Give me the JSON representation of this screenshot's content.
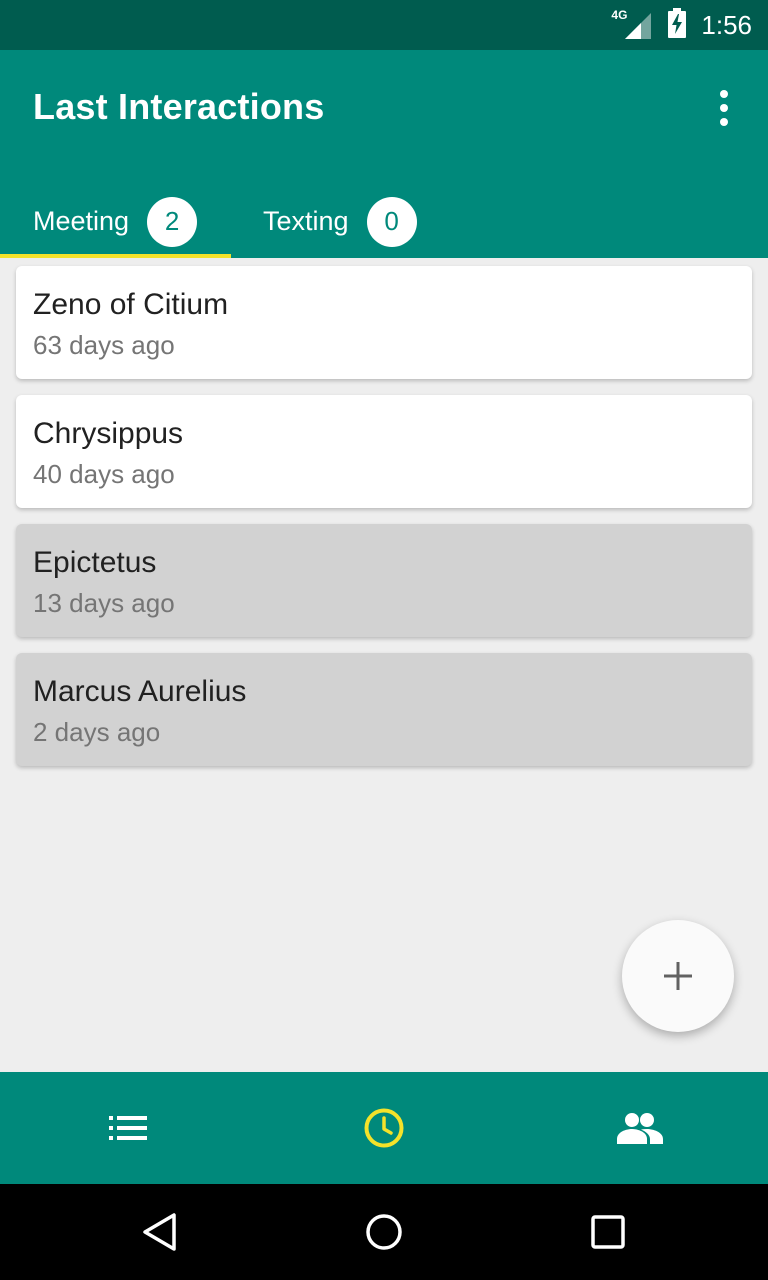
{
  "status_bar": {
    "network": "4G",
    "time": "1:56"
  },
  "app_bar": {
    "title": "Last Interactions",
    "overflow_icon": "more-vert-icon"
  },
  "tabs": [
    {
      "label": "Meeting",
      "count": "2",
      "selected": true
    },
    {
      "label": "Texting",
      "count": "0",
      "selected": false
    }
  ],
  "interactions": [
    {
      "name": "Zeno of Citium",
      "time": "63 days ago",
      "highlighted": false
    },
    {
      "name": "Chrysippus",
      "time": "40 days ago",
      "highlighted": false
    },
    {
      "name": "Epictetus",
      "time": "13 days ago",
      "highlighted": true
    },
    {
      "name": "Marcus Aurelius",
      "time": "2 days ago",
      "highlighted": true
    }
  ],
  "fab": {
    "icon": "plus-icon"
  },
  "bottom_nav": [
    {
      "icon": "list-icon",
      "active": false
    },
    {
      "icon": "clock-icon",
      "active": true
    },
    {
      "icon": "people-icon",
      "active": false
    }
  ],
  "system_nav": [
    "back-icon",
    "home-icon",
    "recents-icon"
  ],
  "colors": {
    "primary": "#00897b",
    "primary_dark": "#005c4f",
    "accent": "#f4e22a",
    "background": "#eeeeee",
    "card_selected": "#d2d2d2"
  }
}
